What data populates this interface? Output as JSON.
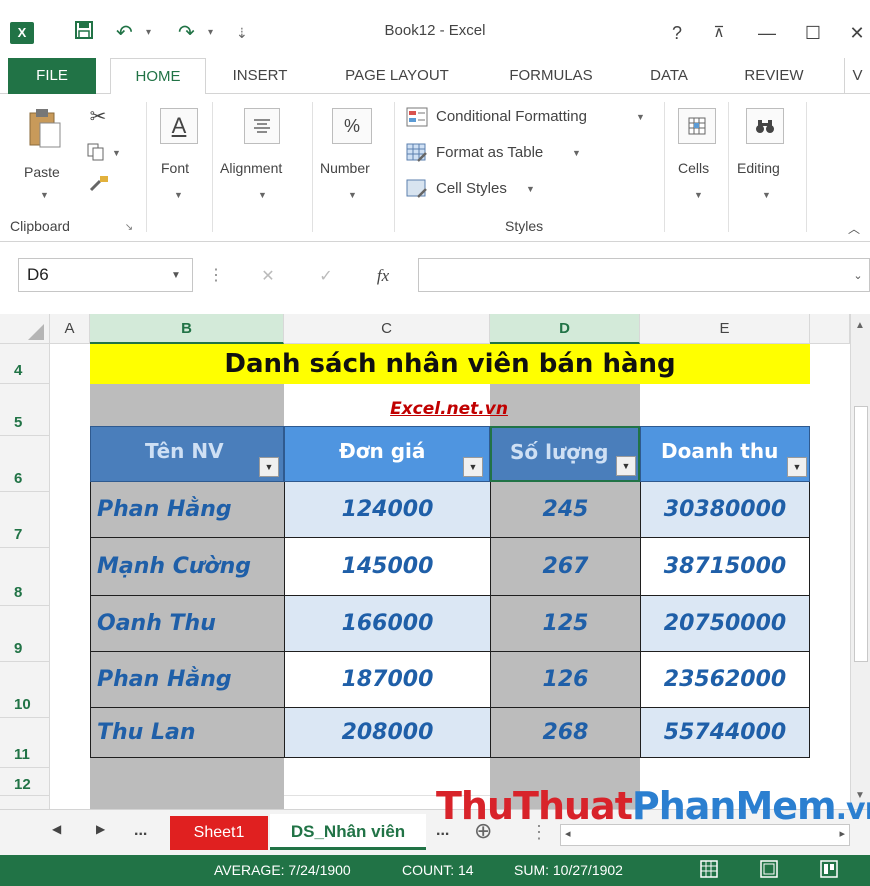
{
  "window": {
    "title": "Book12 - Excel",
    "help": "?",
    "restore_ribbon": "⊼",
    "minimize": "—",
    "maximize": "☐",
    "close": "✕",
    "app_icon": "X",
    "save_icon": "💾",
    "undo_icon": "↶",
    "redo_icon": "↷",
    "qat_more": "⇣"
  },
  "tabs": [
    "FILE",
    "HOME",
    "INSERT",
    "PAGE LAYOUT",
    "FORMULAS",
    "DATA",
    "REVIEW",
    "V"
  ],
  "ribbon": {
    "clipboard": {
      "paste": "Paste",
      "group": "Clipboard"
    },
    "font": {
      "label": "Font",
      "icon": "A"
    },
    "alignment": {
      "label": "Alignment"
    },
    "number": {
      "label": "Number",
      "icon": "%"
    },
    "styles": {
      "conditional": "Conditional Formatting",
      "format_table": "Format as Table",
      "cell_styles": "Cell Styles",
      "group": "Styles"
    },
    "cells": {
      "label": "Cells"
    },
    "editing": {
      "label": "Editing"
    }
  },
  "formula_bar": {
    "name_box": "D6",
    "fx": "fx",
    "value": ""
  },
  "columns": [
    "A",
    "B",
    "C",
    "D",
    "E"
  ],
  "rows": [
    "4",
    "5",
    "6",
    "7",
    "8",
    "9",
    "10",
    "11",
    "12"
  ],
  "sheet": {
    "title": "Danh sách nhân viên bán hàng",
    "subtitle": "Excel.net.vn",
    "headers": [
      "Tên NV",
      "Đơn giá",
      "Số lượng",
      "Doanh thu"
    ],
    "records": [
      [
        "Phan Hằng",
        "124000",
        "245",
        "30380000"
      ],
      [
        "Mạnh Cường",
        "145000",
        "267",
        "38715000"
      ],
      [
        "Oanh Thu",
        "166000",
        "125",
        "20750000"
      ],
      [
        "Phan Hằng",
        "187000",
        "126",
        "23562000"
      ],
      [
        "Thu Lan",
        "208000",
        "268",
        "55744000"
      ]
    ]
  },
  "sheet_tabs": {
    "ellipsis": "...",
    "sheet1": "Sheet1",
    "active": "DS_Nhân viên",
    "more": "...",
    "add": "⊕"
  },
  "watermark": {
    "part1": "ThuThuat",
    "part2": "PhanMem",
    "part3": ".vn"
  },
  "status": {
    "average": "AVERAGE: 7/24/1900",
    "count": "COUNT: 14",
    "sum": "SUM: 10/27/1902"
  },
  "colors": {
    "excel_green": "#217346",
    "title_yellow": "#ffff00",
    "header_blue": "#4f81bd",
    "link_red": "#c00000",
    "data_blue": "#1f5fa8"
  }
}
